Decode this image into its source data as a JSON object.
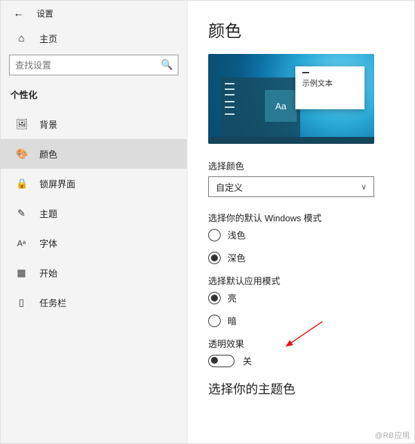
{
  "header": {
    "title": "设置"
  },
  "sidebar": {
    "home_label": "主页",
    "search_placeholder": "查找设置",
    "section_title": "个性化",
    "items": [
      {
        "label": "背景"
      },
      {
        "label": "颜色"
      },
      {
        "label": "锁屏界面"
      },
      {
        "label": "主题"
      },
      {
        "label": "字体"
      },
      {
        "label": "开始"
      },
      {
        "label": "任务栏"
      }
    ]
  },
  "main": {
    "page_title": "颜色",
    "preview": {
      "tile_text": "Aa",
      "card_text": "示例文本"
    },
    "color_select": {
      "label": "选择颜色",
      "value": "自定义"
    },
    "windows_mode": {
      "label": "选择你的默认 Windows 模式",
      "option_light": "浅色",
      "option_dark": "深色",
      "selected": "dark"
    },
    "app_mode": {
      "label": "选择默认应用模式",
      "option_light": "亮",
      "option_dark": "暗",
      "selected": "light"
    },
    "transparency": {
      "label": "透明效果",
      "state_text": "关",
      "on": false
    },
    "accent_heading": "选择你的主题色"
  },
  "watermark": "@RB应用"
}
